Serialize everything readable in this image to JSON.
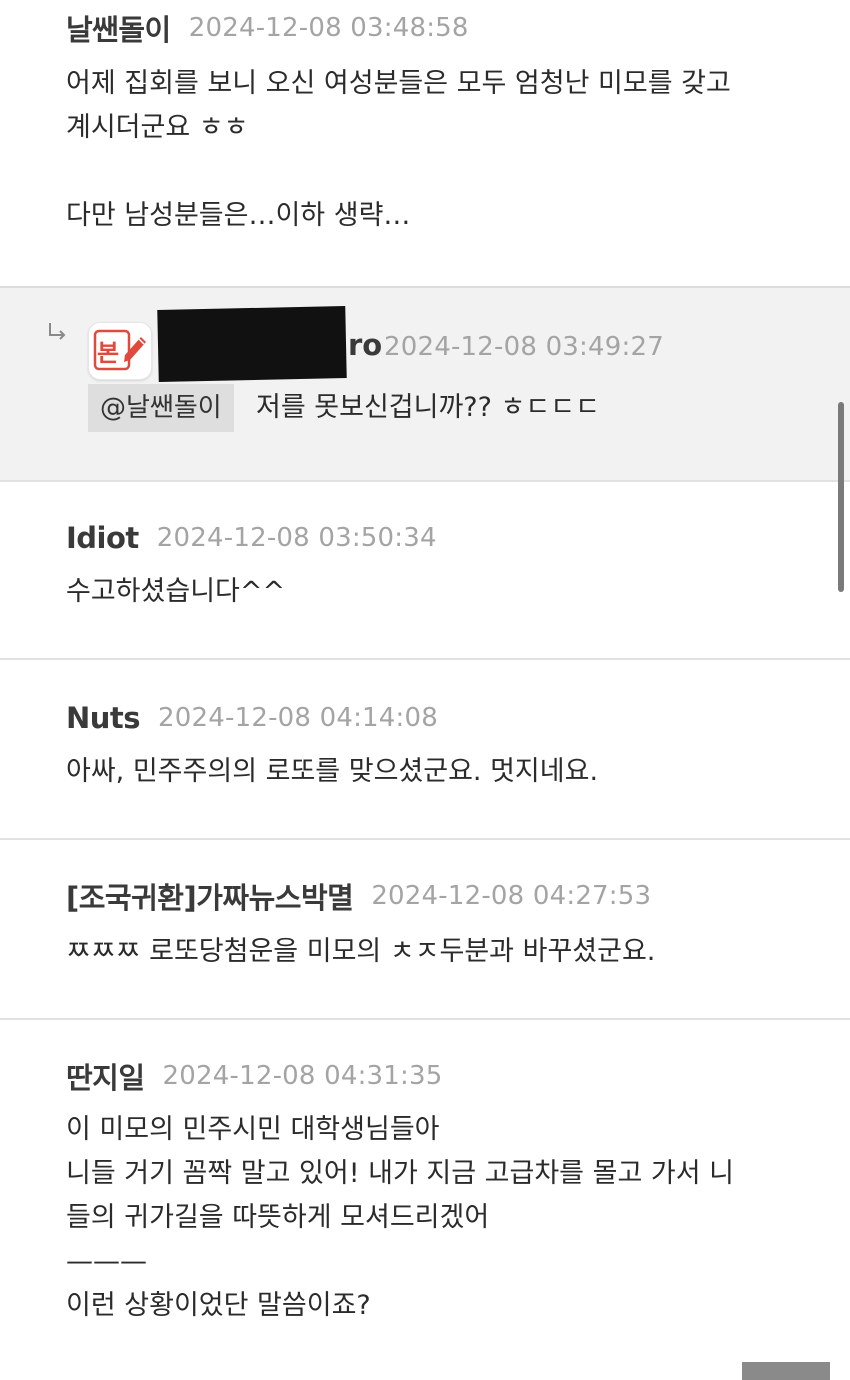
{
  "comments": [
    {
      "author": "날쌘돌이",
      "date": "2024-12-08 03:48:58",
      "lines": [
        "어제 집회를 보니 오신 여성분들은 모두 엄청난 미모를 갖고",
        "계시더군요 ㅎㅎ",
        "",
        "다만 남성분들은…이하 생략…"
      ]
    },
    {
      "author_visible": "ro",
      "date": "2024-12-08 03:49:27",
      "badge_text": "본",
      "mention": "@날쌘돌이",
      "text": "저를 못보신겁니까?? ㅎㄷㄷㄷ"
    },
    {
      "author": "Idiot",
      "date": "2024-12-08 03:50:34",
      "lines": [
        "수고하셨습니다^^"
      ]
    },
    {
      "author": "Nuts",
      "date": "2024-12-08 04:14:08",
      "lines": [
        "아싸, 민주주의의 로또를 맞으셨군요. 멋지네요."
      ]
    },
    {
      "author": "[조국귀환]가짜뉴스박멸",
      "date": "2024-12-08 04:27:53",
      "lines": [
        "ㅉㅉㅉ 로또당첨운을 미모의 ㅊㅈ두분과 바꾸셨군요."
      ]
    },
    {
      "author": "딴지일",
      "date": "2024-12-08 04:31:35",
      "lines": [
        "이 미모의 민주시민 대학생님들아",
        "니들 거기 꼼짝 말고 있어! 내가 지금 고급차를 몰고 가서 니",
        "들의 귀가길을 따뜻하게 모셔드리겠어",
        "———",
        "이런 상황이었단 말씀이죠?"
      ]
    }
  ],
  "icons": {
    "reply_arrow": "reply-arrow-icon",
    "badge": "author-badge-icon"
  },
  "colors": {
    "reply_background": "#f2f2f2",
    "date_text": "#a4a4a4",
    "badge_red": "#e04a3c"
  }
}
